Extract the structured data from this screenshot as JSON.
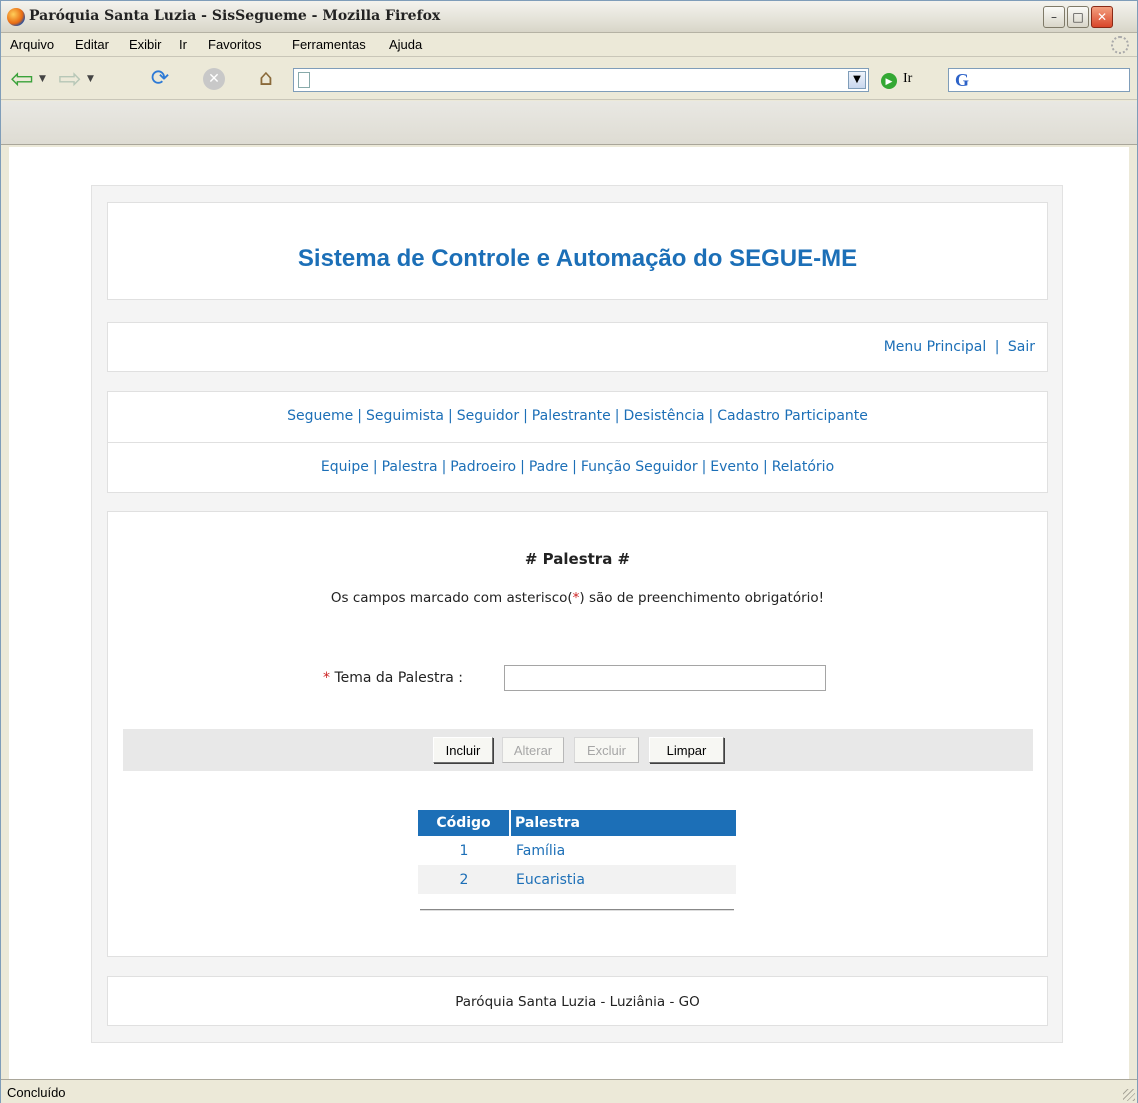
{
  "window": {
    "title": "Paróquia Santa Luzia - SisSegueme - Mozilla Firefox",
    "min_label": "–",
    "max_label": "□",
    "close_label": "✕"
  },
  "menubar": [
    "Arquivo",
    "Editar",
    "Exibir",
    "Ir",
    "Favoritos",
    "Ferramentas",
    "Ajuda"
  ],
  "toolbar": {
    "url_value": "",
    "go_label": "Ir",
    "search_value": ""
  },
  "header": {
    "title": "Sistema de Controle e Automação do SEGUE-ME"
  },
  "top_links": {
    "menu_principal": "Menu Principal",
    "separator": "|",
    "sair": "Sair"
  },
  "menu": {
    "row1": [
      "Segueme",
      "Seguimista",
      "Seguidor",
      "Palestrante",
      "Desistência",
      "Cadastro Participante"
    ],
    "row2": [
      "Equipe",
      "Palestra",
      "Padroeiro",
      "Padre",
      "Função Seguidor",
      "Evento",
      "Relatório"
    ],
    "separator": "|"
  },
  "form": {
    "heading": "# Palestra #",
    "notice_before": "Os campos marcado com asterisco(",
    "notice_asterisk": "*",
    "notice_after": ") são de preenchimento obrigatório!",
    "field_required_mark": "*",
    "field_label": "Tema da Palestra :",
    "field_value": "",
    "buttons": {
      "incluir": "Incluir",
      "alterar": "Alterar",
      "excluir": "Excluir",
      "limpar": "Limpar"
    }
  },
  "table": {
    "headers": [
      "Código",
      "Palestra"
    ],
    "rows": [
      {
        "codigo": "1",
        "palestra": "Família"
      },
      {
        "codigo": "2",
        "palestra": "Eucaristia"
      }
    ]
  },
  "footer": {
    "text": "Paróquia Santa Luzia - Luziânia - GO"
  },
  "status": {
    "text": "Concluído"
  },
  "colors": {
    "accent": "#1c6fb7",
    "required": "#cc2222"
  }
}
